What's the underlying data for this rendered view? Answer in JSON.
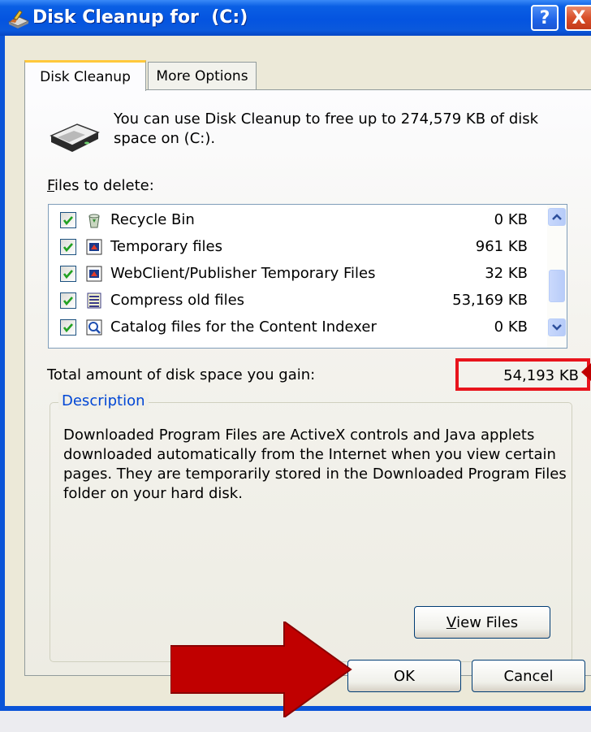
{
  "window": {
    "title": "Disk Cleanup for  (C:)",
    "title_icon": "disk-cleanup-icon",
    "help_label": "?",
    "close_label": "X"
  },
  "tabs": [
    {
      "label": "Disk Cleanup",
      "selected": true
    },
    {
      "label": "More Options",
      "selected": false
    }
  ],
  "intro": {
    "icon": "hard-drive-icon",
    "text": "You can use Disk Cleanup to free up to 274,579 KB of disk space on  (C:)."
  },
  "files_to_delete": {
    "label_underlined": "F",
    "label_rest": "iles to delete:",
    "items": [
      {
        "name": "Recycle Bin",
        "size": "0 KB",
        "checked": true,
        "icon": "recycle-bin-icon"
      },
      {
        "name": "Temporary files",
        "size": "961 KB",
        "checked": true,
        "icon": "temp-file-icon"
      },
      {
        "name": "WebClient/Publisher Temporary Files",
        "size": "32 KB",
        "checked": true,
        "icon": "temp-file-icon"
      },
      {
        "name": "Compress old files",
        "size": "53,169 KB",
        "checked": true,
        "icon": "compress-icon"
      },
      {
        "name": "Catalog files for the Content Indexer",
        "size": "0 KB",
        "checked": true,
        "icon": "catalog-search-icon"
      }
    ]
  },
  "total": {
    "label": "Total amount of disk space you gain:",
    "value": "54,193 KB",
    "highlight_color": "#e8141c"
  },
  "description": {
    "title": "Description",
    "text": "Downloaded Program Files are ActiveX controls and Java applets downloaded automatically from the Internet when you view certain pages. They are temporarily stored in the Downloaded Program Files folder on your hard disk."
  },
  "buttons": {
    "view_files_underlined": "V",
    "view_files_rest": "iew Files",
    "ok": "OK",
    "cancel": "Cancel"
  },
  "annotations": {
    "arrow_color": "#cc0000"
  }
}
